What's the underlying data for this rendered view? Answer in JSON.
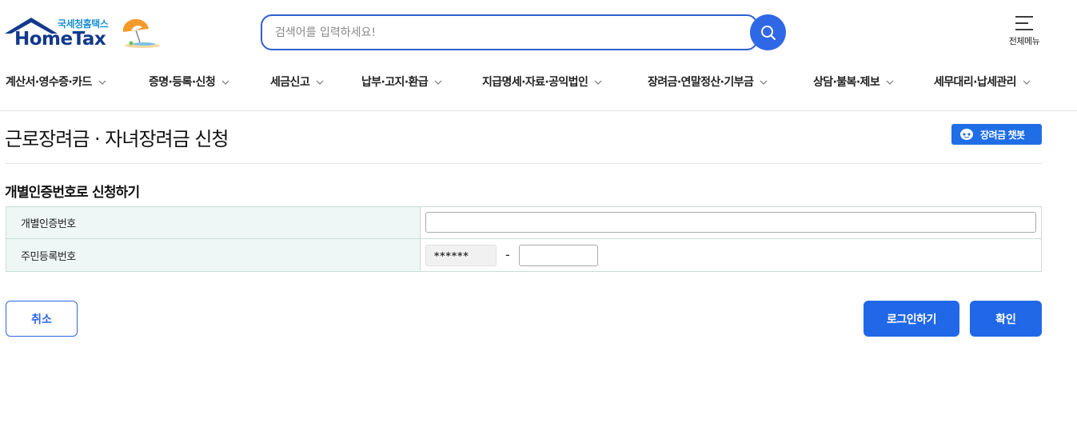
{
  "header": {
    "logo_sub": "국세청홈택스",
    "logo_main": "HomeTax",
    "search_placeholder": "검색어를 입력하세요!",
    "search_value": "",
    "allmenu_label": "전체메뉴"
  },
  "gnb": {
    "items": [
      {
        "label": "계산서·영수증·카드"
      },
      {
        "label": "증명·등록·신청"
      },
      {
        "label": "세금신고"
      },
      {
        "label": "납부·고지·환급"
      },
      {
        "label": "지급명세·자료·공익법인"
      },
      {
        "label": "장려금·연말정산·기부금"
      },
      {
        "label": "상담·불복·제보"
      },
      {
        "label": "세무대리·납세관리"
      }
    ]
  },
  "page": {
    "title": "근로장려금 · 자녀장려금 신청",
    "chatbot_label": "장려금 챗봇",
    "section_title": "개별인증번호로 신청하기"
  },
  "form": {
    "auth_label": "개별인증번호",
    "auth_value": "",
    "rrn_label": "주민등록번호",
    "rrn_front_masked": "******",
    "rrn_dash": "-",
    "rrn_back_value": ""
  },
  "buttons": {
    "cancel": "취소",
    "login": "로그인하기",
    "confirm": "확인"
  },
  "colors": {
    "primary": "#2168e8",
    "logo_navy": "#123a8c",
    "table_header_bg": "#eef7f5"
  }
}
